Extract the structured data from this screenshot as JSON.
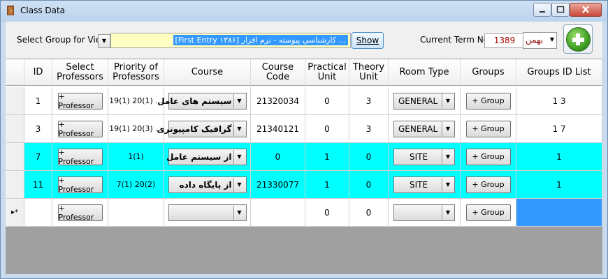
{
  "window": {
    "title": "Class Data"
  },
  "toolbar": {
    "group_label": "Select Group for View:",
    "group_value": "[First Entry ۱۳۸۶] كارشناسي پيوسته - نرم افزار ...",
    "show_label": "Show",
    "term_label": "Current Term No:",
    "term_value": "1389",
    "month_value": "بهمن"
  },
  "grid": {
    "headers": {
      "id": "ID",
      "select_prof": "Select Professors",
      "priority": "Priority of Professors",
      "course": "Course",
      "code": "Course Code",
      "practical": "Practical Unit",
      "theory": "Theory Unit",
      "room": "Room Type",
      "groups": "Groups",
      "groups_id": "Groups ID List"
    },
    "rows": [
      {
        "id": "1",
        "prof_btn": "+ Professor",
        "priority": "19(1)  20(1)  ...",
        "course": "سيستم هاى عامل",
        "code": "21320034",
        "practical": "0",
        "theory": "3",
        "room": "GENERAL",
        "group_btn": "+ Group",
        "groups_id": "1 3"
      },
      {
        "id": "3",
        "prof_btn": "+ Professor",
        "priority": "19(1)  20(3)  ...",
        "course": "گرافيک کامپيوترى",
        "code": "21340121",
        "practical": "0",
        "theory": "3",
        "room": "GENERAL",
        "group_btn": "+ Group",
        "groups_id": "1 7"
      },
      {
        "id": "7",
        "prof_btn": "+ Professor",
        "priority": "1(1)",
        "course": "از سيستم عامل",
        "code": "0",
        "practical": "1",
        "theory": "0",
        "room": "SITE",
        "group_btn": "+ Group",
        "groups_id": "1"
      },
      {
        "id": "11",
        "prof_btn": "+ Professor",
        "priority": "7(1)  20(2)",
        "course": "از پايگاه داده",
        "code": "21330077",
        "practical": "1",
        "theory": "0",
        "room": "SITE",
        "group_btn": "+ Group",
        "groups_id": "1"
      }
    ],
    "new_row": {
      "marker": "▸*",
      "prof_btn": "+ Professor",
      "practical": "0",
      "theory": "0",
      "group_btn": "+ Group"
    }
  }
}
